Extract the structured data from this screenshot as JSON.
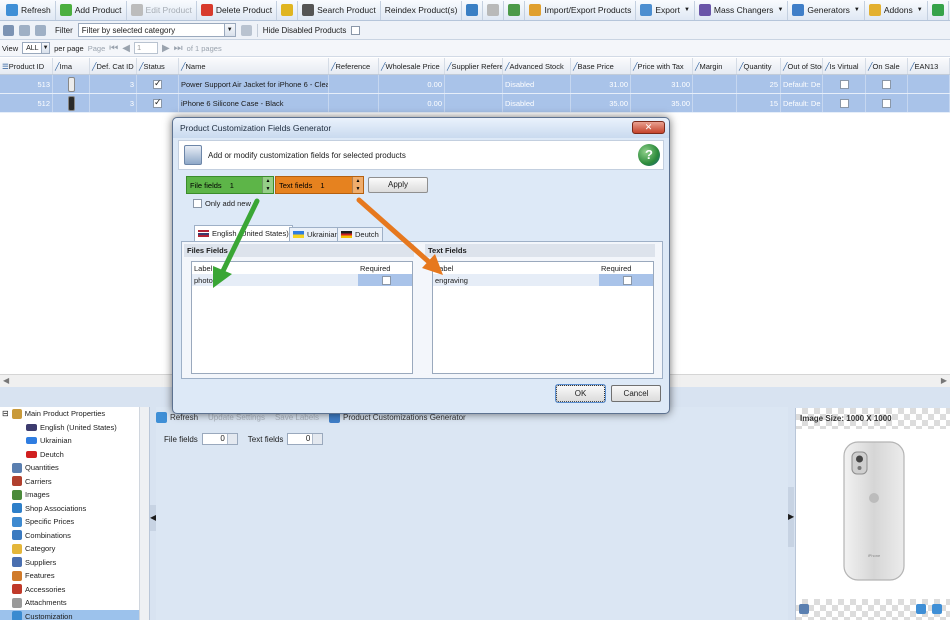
{
  "toolbar": {
    "items": [
      {
        "label": "Refresh",
        "icon": "refresh-icon",
        "color": "#3f8fd6",
        "enabled": true
      },
      {
        "label": "Add Product",
        "icon": "add-icon",
        "color": "#4caf3f",
        "enabled": true
      },
      {
        "label": "Edit Product",
        "icon": "edit-icon",
        "color": "#bcbcbc",
        "enabled": false
      },
      {
        "label": "Delete Product",
        "icon": "delete-icon",
        "color": "#d83a2c",
        "enabled": true
      },
      {
        "label": "",
        "icon": "bulb-icon",
        "color": "#e0b520",
        "enabled": true
      },
      {
        "label": "Search Product",
        "icon": "binoculars-icon",
        "color": "#555555",
        "enabled": true
      },
      {
        "label": "Reindex Product(s)",
        "icon": "",
        "color": "",
        "enabled": true
      },
      {
        "label": "",
        "icon": "copy-icon",
        "color": "#3a7fc4",
        "enabled": true
      },
      {
        "label": "",
        "icon": "paste-icon",
        "color": "#b9b9b9",
        "enabled": false
      },
      {
        "label": "",
        "icon": "clone-icon",
        "color": "#4c9a48",
        "enabled": true
      },
      {
        "label": "Import/Export Products",
        "icon": "import-export-icon",
        "color": "#e0a030",
        "enabled": true
      },
      {
        "label": "Export",
        "icon": "export-icon",
        "color": "#4c8ed0",
        "enabled": true,
        "dropdown": true
      },
      {
        "label": "Mass Changers",
        "icon": "mass-change-icon",
        "color": "#6a55a8",
        "enabled": true,
        "dropdown": true
      },
      {
        "label": "Generators",
        "icon": "generator-icon",
        "color": "#3f7ec8",
        "enabled": true,
        "dropdown": true
      },
      {
        "label": "Addons",
        "icon": "addons-icon",
        "color": "#e3b030",
        "enabled": true,
        "dropdown": true
      },
      {
        "label": "",
        "icon": "panel-icon",
        "color": "#36a34a",
        "enabled": true
      },
      {
        "label": "",
        "icon": "window-icon",
        "color": "#8aa2c0",
        "enabled": true
      },
      {
        "label": "",
        "icon": "layout-icon",
        "color": "#8aa2c0",
        "enabled": true
      },
      {
        "label": "",
        "icon": "tree-icon",
        "color": "#6a7f9a",
        "enabled": true
      }
    ]
  },
  "filterbar": {
    "label": "Filter",
    "selected": "Filter by selected category",
    "hide_disabled": "Hide Disabled Products"
  },
  "pager": {
    "view_label": "View",
    "view_value": "ALL",
    "per_page": "per page",
    "page_label": "Page",
    "page_value": "1",
    "of_pages": "of 1 pages"
  },
  "grid": {
    "columns": [
      {
        "label": "Product ID",
        "w": 53
      },
      {
        "label": "Ima",
        "w": 37
      },
      {
        "label": "Def. Cat ID",
        "w": 47
      },
      {
        "label": "Status",
        "w": 42
      },
      {
        "label": "Name",
        "w": 150
      },
      {
        "label": "Reference",
        "w": 50
      },
      {
        "label": "Wholesale Price",
        "w": 66
      },
      {
        "label": "Supplier Reference",
        "w": 58
      },
      {
        "label": "Advanced Stock",
        "w": 68
      },
      {
        "label": "Base Price",
        "w": 60
      },
      {
        "label": "Price with Tax",
        "w": 62
      },
      {
        "label": "Margin",
        "w": 44
      },
      {
        "label": "Quantity",
        "w": 44
      },
      {
        "label": "Out of Stock",
        "w": 42
      },
      {
        "label": "Is Virtual",
        "w": 43
      },
      {
        "label": "On Sale",
        "w": 42
      },
      {
        "label": "EAN13",
        "w": 42
      }
    ],
    "rows": [
      {
        "id": "513",
        "cat": "3",
        "status": true,
        "name": "Power Support Air Jacket for iPhone 6 - Clear",
        "reference": "",
        "wholesale": "0.00",
        "supplier_ref": "",
        "adv_stock": "Disabled",
        "base": "31.00",
        "tax": "31.00",
        "margin": "",
        "qty": "25",
        "out": "Default: De",
        "virtual": false,
        "sale": false,
        "ean": ""
      },
      {
        "id": "512",
        "cat": "3",
        "status": true,
        "name": "iPhone 6 Silicone Case - Black",
        "reference": "",
        "wholesale": "0.00",
        "supplier_ref": "",
        "adv_stock": "Disabled",
        "base": "35.00",
        "tax": "35.00",
        "margin": "",
        "qty": "15",
        "out": "Default: De",
        "virtual": false,
        "sale": false,
        "ean": ""
      }
    ]
  },
  "dialog": {
    "title": "Product Customization Fields Generator",
    "header_text": "Add or modify customization fields for selected products",
    "file_fields_label": "File fields",
    "file_fields_value": "1",
    "text_fields_label": "Text fields",
    "text_fields_value": "1",
    "apply": "Apply",
    "only_add_new": "Only add new",
    "tabs": [
      {
        "label": "English (United States)",
        "flag": "en"
      },
      {
        "label": "Ukrainian",
        "flag": "ua"
      },
      {
        "label": "Deutch",
        "flag": "de"
      }
    ],
    "files": {
      "title": "Files Fields",
      "col_label": "Label",
      "col_required": "Required",
      "rows": [
        {
          "label": "photo",
          "required": false
        }
      ]
    },
    "texts": {
      "title": "Text Fields",
      "col_label": "Label",
      "col_required": "Required",
      "rows": [
        {
          "label": "engraving",
          "required": false
        }
      ]
    },
    "ok": "OK",
    "cancel": "Cancel",
    "arrow_colors": {
      "green": "#3aa635",
      "orange": "#e6781e"
    },
    "file_color": "#5db548",
    "text_color": "#e6821f"
  },
  "tree": {
    "items": [
      {
        "label": "Main Product Properties",
        "icon": "properties-icon",
        "color": "#c99a3a",
        "sub": false,
        "expander": true
      },
      {
        "label": "English (United States)",
        "icon": "flag-en-icon",
        "color": "#3c3b6e",
        "sub": true
      },
      {
        "label": "Ukrainian",
        "icon": "flag-ua-icon",
        "color": "#2f7de1",
        "sub": true
      },
      {
        "label": "Deutch",
        "icon": "flag-de-icon",
        "color": "#d02020",
        "sub": true
      },
      {
        "label": "Quantities",
        "icon": "quantities-icon",
        "color": "#5a7fb0",
        "sub": false
      },
      {
        "label": "Carriers",
        "icon": "truck-icon",
        "color": "#b0402e",
        "sub": false
      },
      {
        "label": "Images",
        "icon": "images-icon",
        "color": "#4a8a3a",
        "sub": false
      },
      {
        "label": "Shop Associations",
        "icon": "globe-icon",
        "color": "#2e7fc9",
        "sub": false
      },
      {
        "label": "Specific Prices",
        "icon": "prices-icon",
        "color": "#3e8ad0",
        "sub": false
      },
      {
        "label": "Combinations",
        "icon": "combinations-icon",
        "color": "#3b7ac0",
        "sub": false
      },
      {
        "label": "Category",
        "icon": "folder-icon",
        "color": "#e4b63a",
        "sub": false
      },
      {
        "label": "Suppliers",
        "icon": "suppliers-icon",
        "color": "#4a6fb0",
        "sub": false
      },
      {
        "label": "Features",
        "icon": "features-icon",
        "color": "#d07a2a",
        "sub": false
      },
      {
        "label": "Accessories",
        "icon": "accessories-icon",
        "color": "#c03a2a",
        "sub": false
      },
      {
        "label": "Attachments",
        "icon": "attachment-icon",
        "color": "#9a9a9a",
        "sub": false
      },
      {
        "label": "Customization",
        "icon": "customization-icon",
        "color": "#3a8ad0",
        "sub": false,
        "selected": true
      }
    ]
  },
  "panel": {
    "refresh": "Refresh",
    "update": "Update Settings",
    "save_labels": "Save Labels",
    "generator": "Product Customizations Generator",
    "file_label": "File fields",
    "file_value": "0",
    "text_label": "Text fields",
    "text_value": "0"
  },
  "image": {
    "size_label": "Image Size: 1000 X 1000",
    "brand_text": "iPhone"
  }
}
